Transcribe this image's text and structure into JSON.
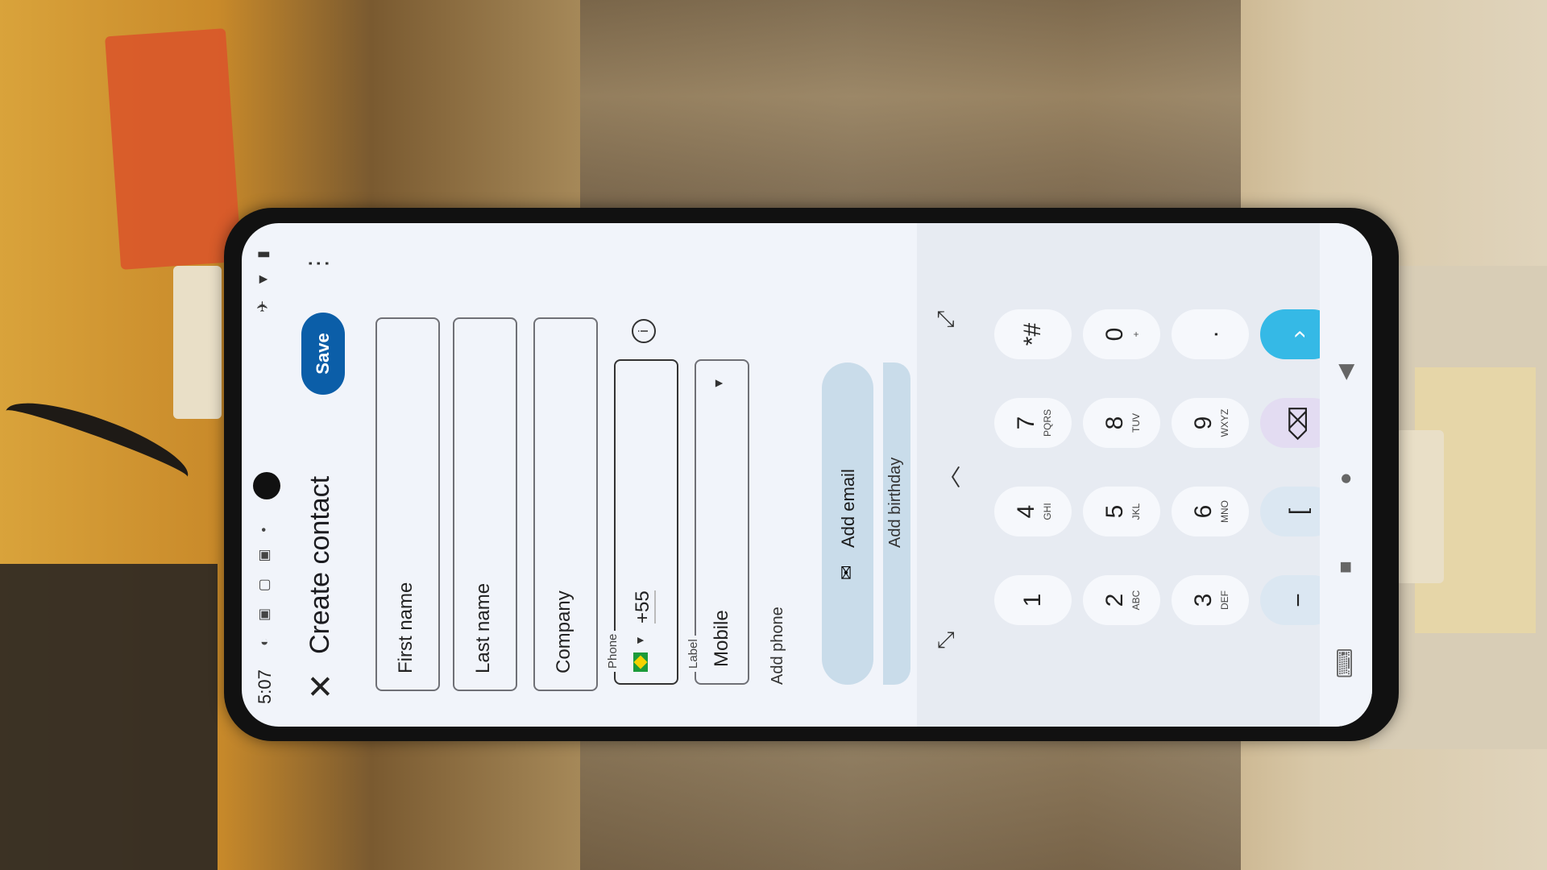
{
  "status": {
    "time": "5:07"
  },
  "appbar": {
    "title": "Create contact",
    "save_label": "Save"
  },
  "fields": {
    "first_name": "First name",
    "last_name": "Last name",
    "company": "Company",
    "phone_label": "Phone",
    "country_code": "+55",
    "label_caption": "Label",
    "label_value": "Mobile"
  },
  "actions": {
    "add_phone": "Add phone",
    "add_email": "Add email",
    "add_birthday": "Add birthday"
  },
  "keyboard": {
    "keys": [
      {
        "d": "1",
        "s": ""
      },
      {
        "d": "2",
        "s": "ABC"
      },
      {
        "d": "3",
        "s": "DEF"
      },
      {
        "d": "−",
        "s": ""
      },
      {
        "d": "4",
        "s": "GHI"
      },
      {
        "d": "5",
        "s": "JKL"
      },
      {
        "d": "6",
        "s": "MNO"
      },
      {
        "d": "[",
        "s": ""
      },
      {
        "d": "7",
        "s": "PQRS"
      },
      {
        "d": "8",
        "s": "TUV"
      },
      {
        "d": "9",
        "s": "WXYZ"
      },
      {
        "d": "⌫",
        "s": ""
      },
      {
        "d": "*#",
        "s": ""
      },
      {
        "d": "0",
        "s": "+"
      },
      {
        "d": ".",
        "s": ""
      },
      {
        "d": "›",
        "s": ""
      }
    ]
  },
  "colors": {
    "accent": "#0b5ea8",
    "enter": "#35b9e6",
    "screen_bg": "#f1f4fa"
  }
}
